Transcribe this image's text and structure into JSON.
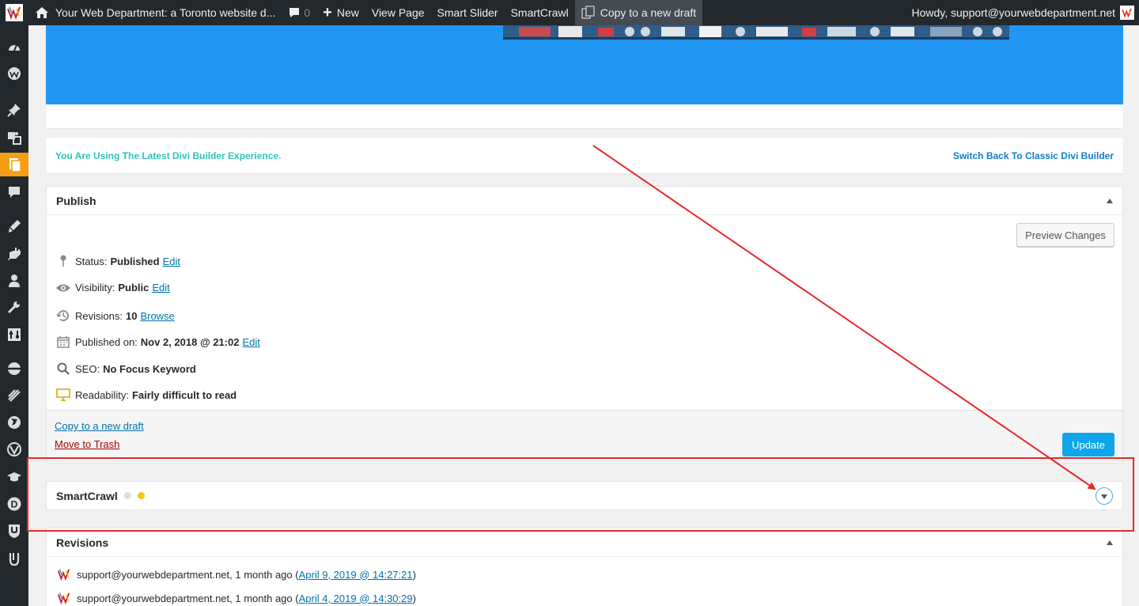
{
  "adminbar": {
    "site_title": "Your Web Department: a Toronto website d...",
    "comments_count": "0",
    "new_label": "New",
    "view_page_label": "View Page",
    "smart_slider_label": "Smart Slider",
    "smartcrawl_label": "SmartCrawl",
    "copy_draft_label": "Copy to a new draft",
    "howdy": "Howdy, support@yourwebdepartment.net"
  },
  "sidebar": {
    "icons": [
      "dashboard-icon",
      "wp-icon",
      "pin-icon",
      "media-icon",
      "pages-icon",
      "comments-icon",
      "appearance-icon",
      "plugins-icon",
      "users-icon",
      "tools-icon",
      "settings-icon",
      "stack-icon",
      "slider-icon",
      "globe-icon",
      "divi-icon",
      "graduation-icon",
      "d-icon",
      "shield-icon",
      "u-icon"
    ],
    "current_index": 4,
    "accent": "#f59e15"
  },
  "divi_notice": {
    "status": "You Are Using The Latest Divi Builder Experience.",
    "switch_link": "Switch Back To Classic Divi Builder"
  },
  "publish": {
    "title": "Publish",
    "preview_button": "Preview Changes",
    "status_label": "Status:",
    "status_value": "Published",
    "status_edit": "Edit",
    "visibility_label": "Visibility:",
    "visibility_value": "Public",
    "visibility_edit": "Edit",
    "revisions_label": "Revisions:",
    "revisions_value": "10",
    "revisions_browse": "Browse",
    "published_label": "Published on:",
    "published_value": "Nov 2, 2018 @ 21:02",
    "published_edit": "Edit",
    "seo_label": "SEO:",
    "seo_value": "No Focus Keyword",
    "readability_label": "Readability:",
    "readability_value": "Fairly difficult to read",
    "copy_draft_link": "Copy to a new draft",
    "trash_link": "Move to Trash",
    "update_button": "Update"
  },
  "smartcrawl": {
    "title": "SmartCrawl",
    "dot1_color": "#dddddd",
    "dot2_color": "#f5c518"
  },
  "revisions": {
    "title": "Revisions",
    "items": [
      {
        "author": "support@yourwebdepartment.net, 1 month ago (",
        "date": "April 9, 2019 @ 14:27:21",
        "close": ")"
      },
      {
        "author": "support@yourwebdepartment.net, 1 month ago (",
        "date": "April 4, 2019 @ 14:30:29",
        "close": ")"
      }
    ]
  },
  "colors": {
    "banner": "#2196f3",
    "annotation": "#e82828",
    "link": "#0073aa",
    "update_button": "#0ea5e9"
  }
}
